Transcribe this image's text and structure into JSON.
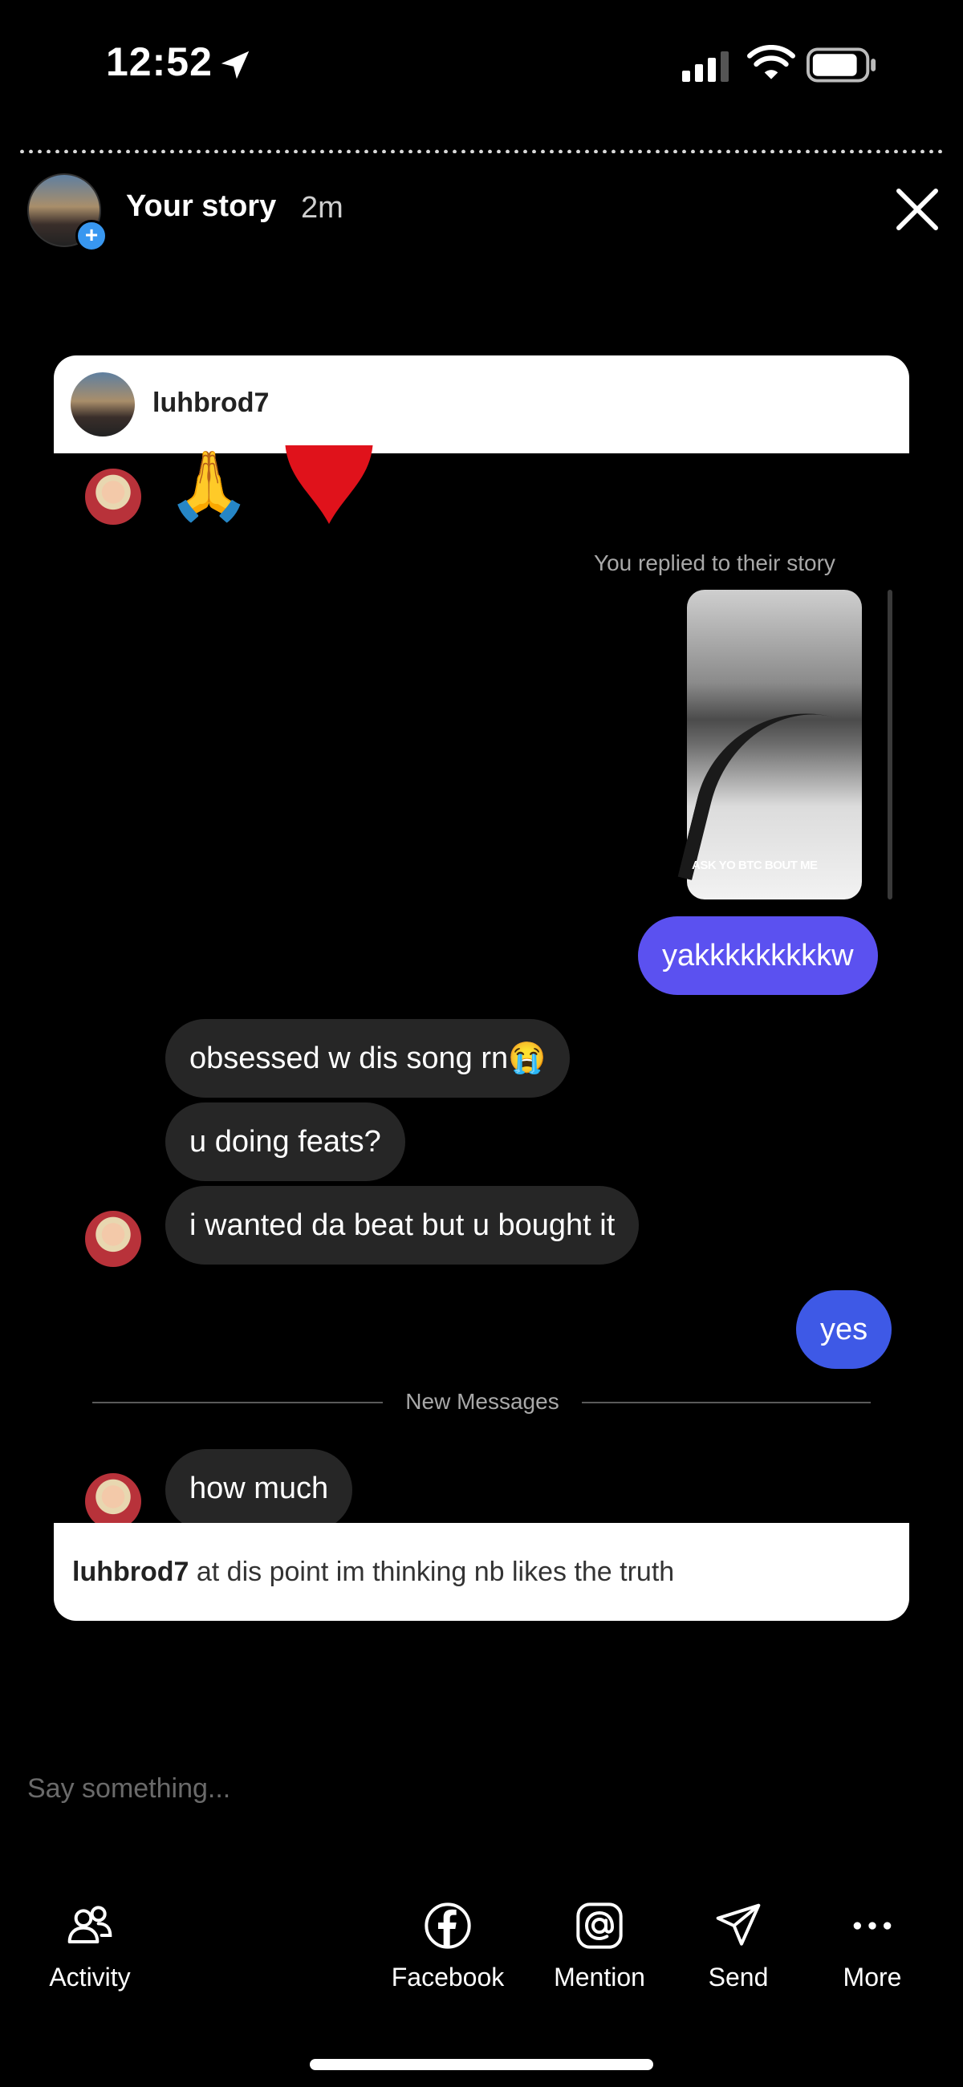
{
  "status_bar": {
    "time": "12:52"
  },
  "story": {
    "title": "Your story",
    "time": "2m"
  },
  "dm_card": {
    "username": "luhbrod7",
    "reply_label": "You replied to their story",
    "story_thumbnail_caption": "ASK YO BTC BOUT ME",
    "messages": [
      {
        "from": "me",
        "text": "yakkkkkkkkkw"
      },
      {
        "from": "them",
        "text": "obsessed w dis song rn😭"
      },
      {
        "from": "them",
        "text": "u doing feats?"
      },
      {
        "from": "them",
        "text": "i wanted da beat but u bought it"
      },
      {
        "from": "me",
        "text": "yes"
      },
      {
        "from": "them",
        "text": "how much"
      }
    ],
    "divider_label": "New Messages",
    "footer_username": "luhbrod7",
    "footer_text": " at dis point im thinking nb likes the truth"
  },
  "reply_input": {
    "placeholder": "Say something..."
  },
  "toolbar": {
    "activity": "Activity",
    "facebook": "Facebook",
    "mention": "Mention",
    "send": "Send",
    "more": "More"
  },
  "colors": {
    "background": "#000000",
    "my_bubble": "#5b51f0",
    "my_bubble_2": "#3e59e6",
    "their_bubble": "#262626",
    "story_add_badge": "#3897f0"
  }
}
